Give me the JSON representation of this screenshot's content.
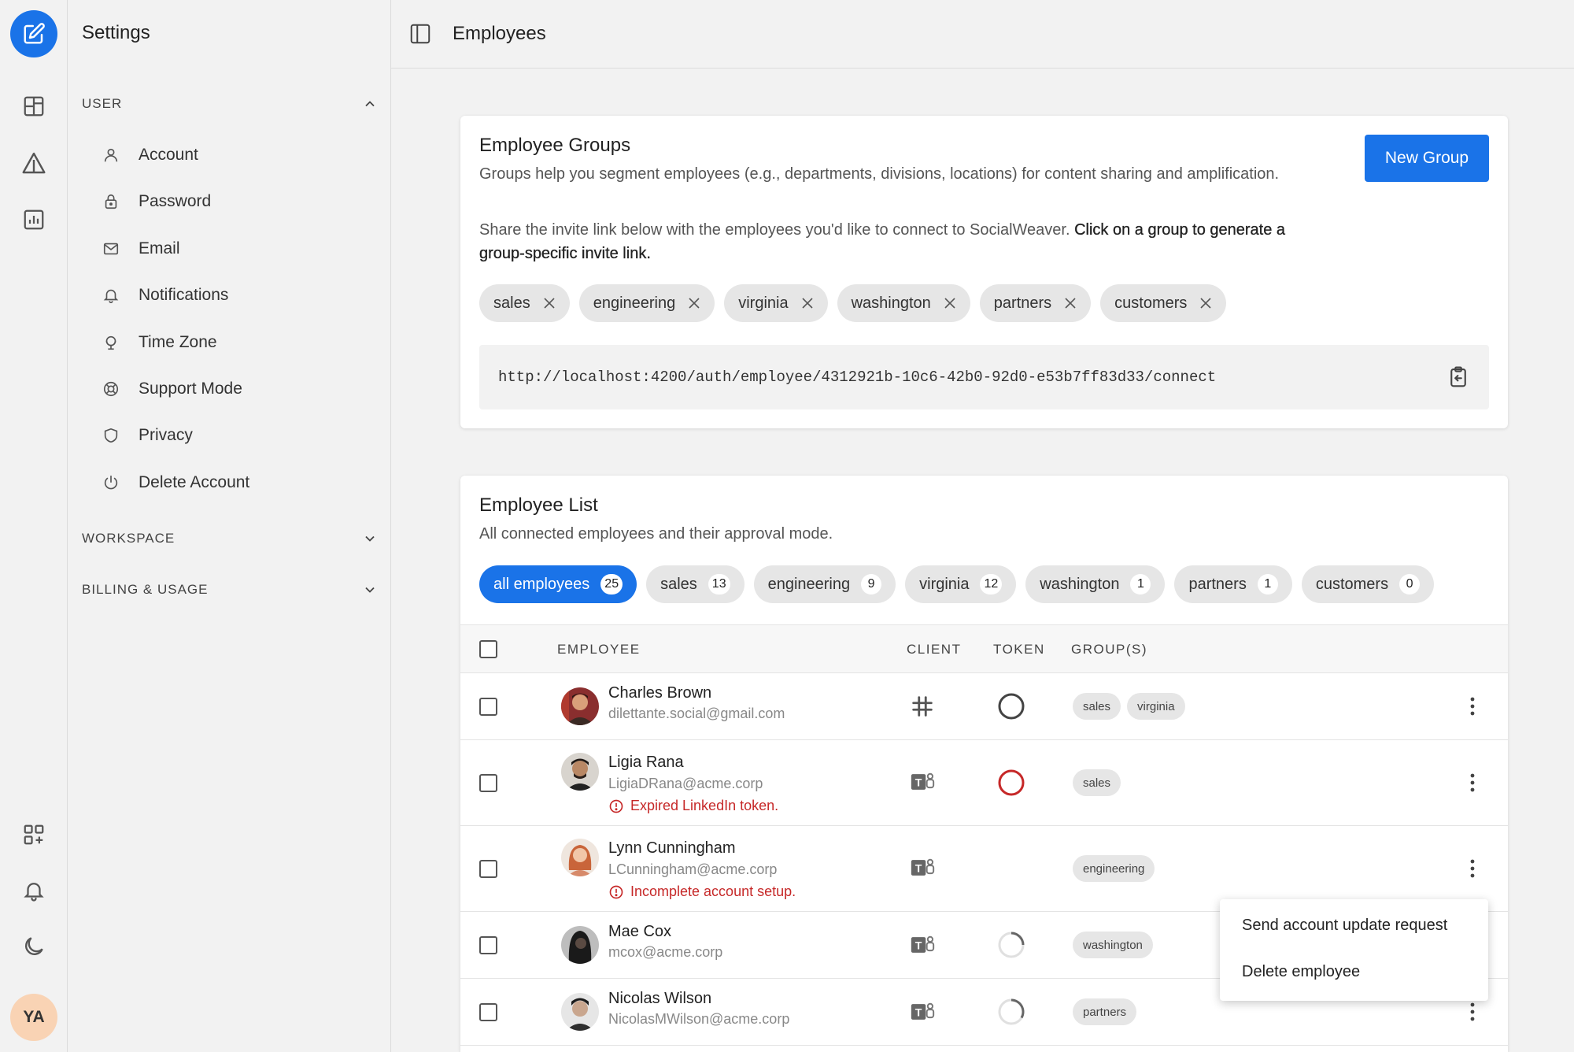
{
  "app": {
    "sidebar_title": "Settings",
    "avatar_initials": "YA"
  },
  "sidebar": {
    "sections": [
      {
        "label": "USER",
        "expanded": true
      },
      {
        "label": "WORKSPACE",
        "expanded": false
      },
      {
        "label": "BILLING & USAGE",
        "expanded": false
      }
    ],
    "items": [
      {
        "label": "Account",
        "icon": "person-icon"
      },
      {
        "label": "Password",
        "icon": "lock-icon"
      },
      {
        "label": "Email",
        "icon": "mail-icon"
      },
      {
        "label": "Notifications",
        "icon": "bell-icon"
      },
      {
        "label": "Time Zone",
        "icon": "globe-icon"
      },
      {
        "label": "Support Mode",
        "icon": "lifebuoy-icon"
      },
      {
        "label": "Privacy",
        "icon": "shield-icon"
      },
      {
        "label": "Delete Account",
        "icon": "power-icon"
      }
    ]
  },
  "header": {
    "title": "Employees"
  },
  "groups_card": {
    "title": "Employee Groups",
    "desc1": "Groups help you segment employees (e.g., departments, divisions, locations) for content sharing and amplification.",
    "desc2_plain": "Share the invite link below with the employees you'd like to connect to SocialWeaver. ",
    "desc2_bold": "Click on a group to generate a group-specific invite link.",
    "new_group_label": "New Group",
    "groups": [
      "sales",
      "engineering",
      "virginia",
      "washington",
      "partners",
      "customers"
    ],
    "invite_url": "http://localhost:4200/auth/employee/4312921b-10c6-42b0-92d0-e53b7ff83d33/connect"
  },
  "list_card": {
    "title": "Employee List",
    "desc": "All connected employees and their approval mode.",
    "filters": [
      {
        "label": "all employees",
        "count": "25",
        "active": true
      },
      {
        "label": "sales",
        "count": "13"
      },
      {
        "label": "engineering",
        "count": "9"
      },
      {
        "label": "virginia",
        "count": "12"
      },
      {
        "label": "washington",
        "count": "1"
      },
      {
        "label": "partners",
        "count": "1"
      },
      {
        "label": "customers",
        "count": "0"
      }
    ],
    "columns": {
      "employee": "EMPLOYEE",
      "client": "CLIENT",
      "token": "TOKEN",
      "groups": "GROUP(S)"
    },
    "rows": [
      {
        "name": "Charles Brown",
        "email": "dilettante.social@gmail.com",
        "warning": "",
        "client": "slack-icon",
        "token": "full",
        "groups": [
          "sales",
          "virginia"
        ]
      },
      {
        "name": "Ligia Rana",
        "email": "LigiaDRana@acme.corp",
        "warning": "Expired LinkedIn token.",
        "client": "teams-icon",
        "token": "expired",
        "groups": [
          "sales"
        ]
      },
      {
        "name": "Lynn Cunningham",
        "email": "LCunningham@acme.corp",
        "warning": "Incomplete account setup.",
        "client": "teams-icon",
        "token": "none",
        "groups": [
          "engineering"
        ]
      },
      {
        "name": "Mae Cox",
        "email": "mcox@acme.corp",
        "warning": "",
        "client": "teams-icon",
        "token": "quarter",
        "groups": [
          "washington"
        ]
      },
      {
        "name": "Nicolas Wilson",
        "email": "NicolasMWilson@acme.corp",
        "warning": "",
        "client": "teams-icon",
        "token": "third",
        "groups": [
          "partners"
        ]
      }
    ]
  },
  "context_menu": {
    "items": [
      "Send account update request",
      "Delete employee"
    ]
  },
  "colors": {
    "accent": "#1a73e8",
    "error": "#c62828"
  }
}
